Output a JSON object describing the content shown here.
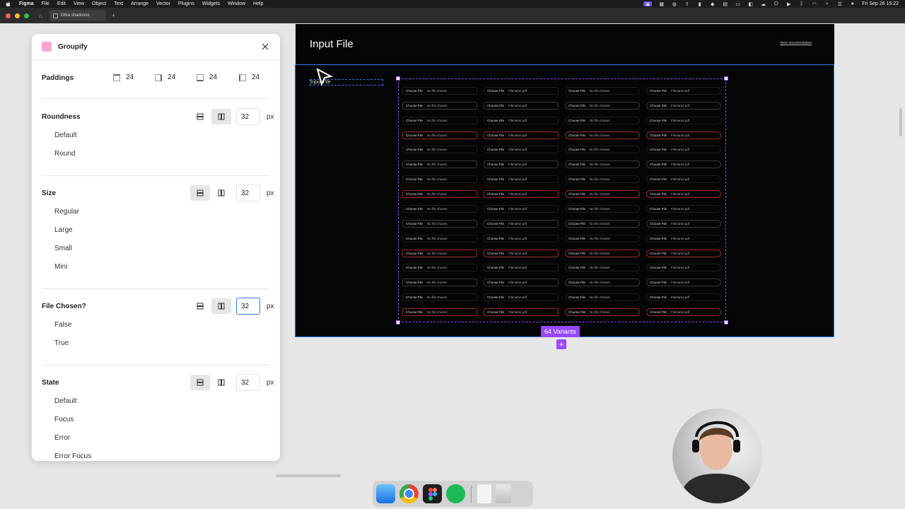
{
  "menubar": {
    "app": "Figma",
    "items": [
      "File",
      "Edit",
      "View",
      "Object",
      "Text",
      "Arrange",
      "Vector",
      "Plugins",
      "Widgets",
      "Window",
      "Help"
    ],
    "clock": "Fri Sep 26  15:22"
  },
  "tabbar": {
    "tab_title": "Obra shadcn/ui"
  },
  "frame": {
    "title": "Input File",
    "doc_link": "View documentation",
    "layer_label": "Input File",
    "variants_badge": "64 Variants",
    "add_label": "+"
  },
  "grid": {
    "choose_label": "Choose File",
    "no_file": "No file chosen",
    "filename": "Filename.pdf",
    "rows": [
      {
        "style": "plain",
        "cols": [
          "no",
          "file",
          "no",
          "file"
        ]
      },
      {
        "style": "bordered",
        "cols": [
          "no",
          "file",
          "no",
          "file"
        ]
      },
      {
        "style": "plain",
        "cols": [
          "no",
          "file",
          "no",
          "file"
        ]
      },
      {
        "style": "error",
        "cols": [
          "no",
          "file",
          "no",
          "file"
        ]
      },
      {
        "style": "plain",
        "cols": [
          "no",
          "file",
          "no",
          "file"
        ]
      },
      {
        "style": "bordered",
        "cols": [
          "no",
          "file",
          "no",
          "file"
        ]
      },
      {
        "style": "plain",
        "cols": [
          "no",
          "file",
          "no",
          "file"
        ]
      },
      {
        "style": "error",
        "cols": [
          "no",
          "file",
          "no",
          "file"
        ]
      },
      {
        "style": "plain",
        "cols": [
          "no",
          "file",
          "no",
          "file"
        ]
      },
      {
        "style": "bordered",
        "cols": [
          "no",
          "file",
          "no",
          "file"
        ]
      },
      {
        "style": "plain",
        "cols": [
          "no",
          "file",
          "no",
          "file"
        ]
      },
      {
        "style": "error",
        "cols": [
          "no",
          "file",
          "no",
          "file"
        ]
      },
      {
        "style": "plain",
        "cols": [
          "no",
          "file",
          "no",
          "file"
        ]
      },
      {
        "style": "bordered",
        "cols": [
          "no",
          "file",
          "no",
          "file"
        ]
      },
      {
        "style": "plain",
        "cols": [
          "no",
          "file",
          "no",
          "file"
        ]
      },
      {
        "style": "error",
        "cols": [
          "no",
          "file",
          "no",
          "file"
        ]
      }
    ]
  },
  "panel": {
    "plugin_name": "Groupify",
    "paddings": {
      "label": "Paddings",
      "top": "24",
      "right": "24",
      "bottom": "24",
      "left": "24"
    },
    "sections": [
      {
        "label": "Roundness",
        "value": "32",
        "unit": "px",
        "active": "horizontal",
        "focused": false,
        "options": [
          "Default",
          "Round"
        ]
      },
      {
        "label": "Size",
        "value": "32",
        "unit": "px",
        "active": "vertical",
        "focused": false,
        "options": [
          "Regular",
          "Large",
          "Small",
          "Mini"
        ]
      },
      {
        "label": "File Chosen?",
        "value": "32",
        "unit": "px",
        "active": "horizontal",
        "focused": true,
        "options": [
          "False",
          "True"
        ]
      },
      {
        "label": "State",
        "value": "32",
        "unit": "px",
        "active": "vertical",
        "focused": false,
        "options": [
          "Default",
          "Focus",
          "Error",
          "Error Focus"
        ]
      }
    ]
  },
  "colors": {
    "accent": "#9747ff",
    "selection": "#2f7bf6",
    "error_border": "#9a2a2a"
  }
}
